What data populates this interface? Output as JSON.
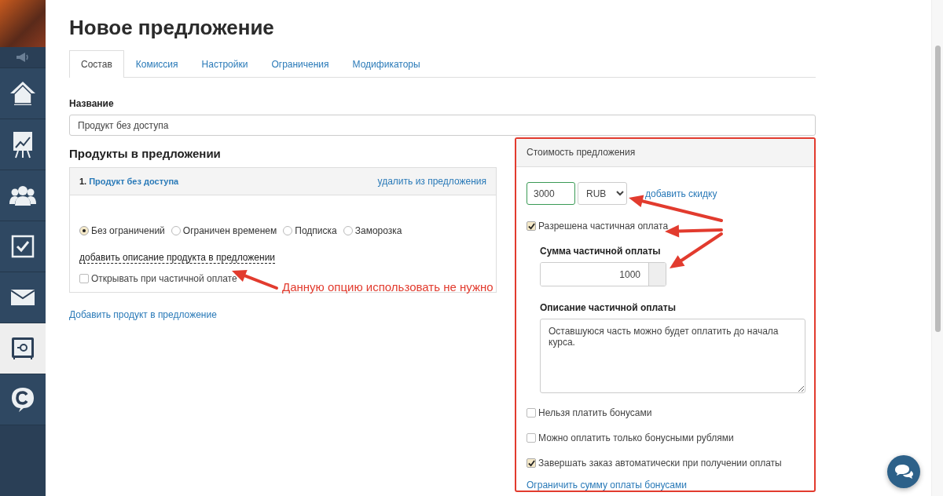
{
  "sidebar": {
    "items": [
      {
        "selected": false
      },
      {
        "selected": false
      },
      {
        "selected": false
      },
      {
        "selected": false
      },
      {
        "selected": false
      },
      {
        "selected": true
      },
      {
        "selected": false
      }
    ]
  },
  "title": "Новое предложение",
  "tabs": [
    {
      "label": "Состав",
      "selected": true
    },
    {
      "label": "Комиссия",
      "selected": false
    },
    {
      "label": "Настройки",
      "selected": false
    },
    {
      "label": "Ограничения",
      "selected": false
    },
    {
      "label": "Модификаторы",
      "selected": false
    }
  ],
  "name_field": {
    "label": "Название",
    "value": "Продукт без доступа"
  },
  "products": {
    "heading": "Продукты в предложении",
    "items": [
      {
        "number": "1.",
        "name": "Продукт без доступа",
        "remove_link": "удалить из предложения",
        "access_options": [
          {
            "label": "Без ограничений",
            "selected": true
          },
          {
            "label": "Ограничен временем",
            "selected": false
          },
          {
            "label": "Подписка",
            "selected": false
          },
          {
            "label": "Заморозка",
            "selected": false
          }
        ],
        "description_link": "добавить описание продукта в предложении",
        "open_on_partial": {
          "label": "Открывать при частичной оплате",
          "checked": false
        }
      }
    ],
    "add_link": "Добавить продукт в предложение"
  },
  "price_panel": {
    "heading": "Стоимость предложения",
    "price": "3000",
    "currency": "RUB",
    "discount_link": "добавить скидку",
    "partial_payment": {
      "label": "Разрешена частичная оплата",
      "checked": true
    },
    "partial_sum": {
      "label": "Сумма частичной оплаты",
      "value": "1000"
    },
    "partial_description": {
      "label": "Описание частичной оплаты",
      "value": "Оставшуюся часть можно будет оплатить до начала курса."
    },
    "options": [
      {
        "label": "Нельзя платить бонусами",
        "checked": false
      },
      {
        "label": "Можно оплатить только бонусными рублями",
        "checked": false
      },
      {
        "label": "Завершать заказ автоматически при получении оплаты",
        "checked": true
      }
    ],
    "bonus_limit_link": "Ограничить сумму оплаты бонусами"
  },
  "annotation": {
    "text": "Данную опцию использовать не нужно"
  }
}
